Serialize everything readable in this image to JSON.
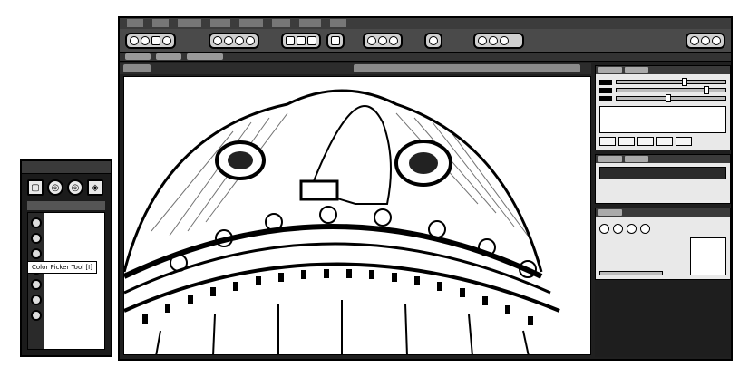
{
  "tool_panel": {
    "tooltip": "Color Picker Tool [I]"
  },
  "icons": {
    "tool_buttons": [
      "brush-icon",
      "zoom-icon",
      "hand-icon",
      "rotate-icon"
    ],
    "toolbar_groups": [
      "file-tools-icon",
      "edit-tools-icon",
      "view-tools-icon",
      "layer-tools-icon",
      "transform-tools-icon",
      "brush-tools-icon",
      "color-tools-icon",
      "window-tools-icon"
    ]
  },
  "colors": {
    "chrome_dark": "#202020",
    "chrome_mid": "#4a4a4a",
    "canvas_bg": "#ffffff"
  }
}
